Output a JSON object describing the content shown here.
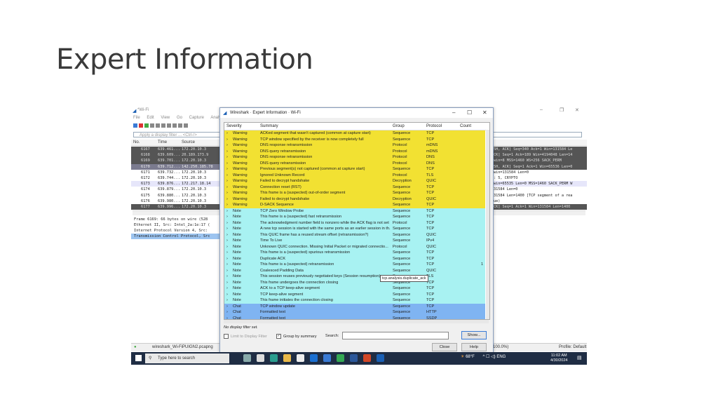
{
  "slide": {
    "title": "Expert Information"
  },
  "main_window": {
    "title": "*Wi-Fi",
    "menu": [
      "File",
      "Edit",
      "View",
      "Go",
      "Capture",
      "Analyze"
    ],
    "filter_placeholder": "Apply a display filter ... <Ctrl-/>",
    "columns": {
      "no": "No.",
      "time": "Time",
      "source": "Source"
    },
    "packets": [
      {
        "no": "6167",
        "time": "639.461...",
        "src": "172.20.10.3",
        "style": "dark"
      },
      {
        "no": "6168",
        "time": "639.609...",
        "src": "20.189.173.9",
        "style": "dark"
      },
      {
        "no": "6169",
        "time": "639.701...",
        "src": "172.20.10.3",
        "style": "dark"
      },
      {
        "no": "6170",
        "time": "639.712...",
        "src": "142.250.185.78",
        "style": "sel"
      },
      {
        "no": "6171",
        "time": "639.732...",
        "src": "172.20.10.3",
        "style": "plain"
      },
      {
        "no": "6172",
        "time": "639.744...",
        "src": "172.20.10.3",
        "style": "plain"
      },
      {
        "no": "6173",
        "time": "639.876...",
        "src": "172.217.18.14",
        "style": "lt"
      },
      {
        "no": "6174",
        "time": "639.879...",
        "src": "172.20.10.3",
        "style": "plain"
      },
      {
        "no": "6175",
        "time": "639.880...",
        "src": "172.20.10.3",
        "style": "plain"
      },
      {
        "no": "6176",
        "time": "639.980...",
        "src": "172.20.10.3",
        "style": "plain"
      },
      {
        "no": "6177",
        "time": "639.996...",
        "src": "172.20.10.3",
        "style": "dark"
      }
    ],
    "info_right": [
      {
        "text": "5H, ACK] Seq=340 Ack=1 Win=131584 Le",
        "style": "dark"
      },
      {
        "text": "CK] Seq=1 Ack=189 Win=4194048 Len=14",
        "style": "dark"
      },
      {
        "text": "win=8 MSS=1460 WS=256 SACK_PERM",
        "style": "dark"
      },
      {
        "text": "5H, ACK] Seq=1 Ack=1 Win=65536 Len=0",
        "style": "sel"
      },
      {
        "text": "win=131584 Len=0",
        "style": "plain"
      },
      {
        "text": ": 5, CRYPTO",
        "style": "plain"
      },
      {
        "text": "win=65535 Len=0 MSS=1460 SACK_PERM W",
        "style": "lt"
      },
      {
        "text": "31584 Len=0",
        "style": "plain"
      },
      {
        "text": "31584 Len=1400 [TCP segment of a rea",
        "style": "plain"
      },
      {
        "text": "ue)",
        "style": "plain"
      },
      {
        "text": "CK] Seq=1 Ack=1 Win=131584 Len=1400",
        "style": "dark"
      }
    ],
    "details": [
      "Frame 6169: 66 bytes on wire (528",
      "Ethernet II, Src: Intel_2a:1e:17 (",
      "Internet Protocol Version 4, Src:",
      "Transmission Control Protocol, Src"
    ],
    "status": {
      "file": "wireshark_Wi-FiPUIGN2.pcapng",
      "pct": "100.0%)",
      "profile": "Profile: Default"
    }
  },
  "dialog": {
    "title": "Wireshark · Expert Information · Wi-Fi",
    "columns": {
      "severity": "Severity",
      "summary": "Summary",
      "group": "Group",
      "protocol": "Protocol",
      "count": "Count"
    },
    "rows": [
      {
        "sev": "Warning",
        "sum": "ACKed segment that wasn't captured (common at capture start)",
        "grp": "Sequence",
        "proto": "TCP",
        "count": "",
        "cls": "warn"
      },
      {
        "sev": "Warning",
        "sum": "TCP window specified by the receiver is now completely full",
        "grp": "Sequence",
        "proto": "TCP",
        "count": "",
        "cls": "warn"
      },
      {
        "sev": "Warning",
        "sum": "DNS response retransmission",
        "grp": "Protocol",
        "proto": "mDNS",
        "count": "",
        "cls": "warn"
      },
      {
        "sev": "Warning",
        "sum": "DNS query retransmission",
        "grp": "Protocol",
        "proto": "mDNS",
        "count": "",
        "cls": "warn"
      },
      {
        "sev": "Warning",
        "sum": "DNS response retransmission",
        "grp": "Protocol",
        "proto": "DNS",
        "count": "",
        "cls": "warn"
      },
      {
        "sev": "Warning",
        "sum": "DNS query retransmission",
        "grp": "Protocol",
        "proto": "DNS",
        "count": "",
        "cls": "warn"
      },
      {
        "sev": "Warning",
        "sum": "Previous segment(s) not captured (common at capture start)",
        "grp": "Sequence",
        "proto": "TCP",
        "count": "",
        "cls": "warn"
      },
      {
        "sev": "Warning",
        "sum": "Ignored Unknown Record",
        "grp": "Protocol",
        "proto": "TLS",
        "count": "",
        "cls": "warn"
      },
      {
        "sev": "Warning",
        "sum": "Failed to decrypt handshake",
        "grp": "Decryption",
        "proto": "QUIC",
        "count": "",
        "cls": "warn"
      },
      {
        "sev": "Warning",
        "sum": "Connection reset (RST)",
        "grp": "Sequence",
        "proto": "TCP",
        "count": "",
        "cls": "warn"
      },
      {
        "sev": "Warning",
        "sum": "This frame is a (suspected) out-of-order segment",
        "grp": "Sequence",
        "proto": "TCP",
        "count": "",
        "cls": "warn"
      },
      {
        "sev": "Warning",
        "sum": "Failed to decrypt handshake",
        "grp": "Decryption",
        "proto": "QUIC",
        "count": "",
        "cls": "warn"
      },
      {
        "sev": "Warning",
        "sum": "D-SACK Sequence",
        "grp": "Sequence",
        "proto": "TCP",
        "count": "",
        "cls": "warn"
      },
      {
        "sev": "Note",
        "sum": "TCP Zero Window Probe",
        "grp": "Sequence",
        "proto": "TCP",
        "count": "",
        "cls": "note"
      },
      {
        "sev": "Note",
        "sum": "This frame is a (suspected) fast retransmission",
        "grp": "Sequence",
        "proto": "TCP",
        "count": "",
        "cls": "note"
      },
      {
        "sev": "Note",
        "sum": "The acknowledgment number field is nonzero while the ACK flag is not set",
        "grp": "Protocol",
        "proto": "TCP",
        "count": "",
        "cls": "note"
      },
      {
        "sev": "Note",
        "sum": "A new tcp session is started with the same ports as an earlier session in th...",
        "grp": "Sequence",
        "proto": "TCP",
        "count": "",
        "cls": "note"
      },
      {
        "sev": "Note",
        "sum": "This QUIC frame has a reused stream offset (retransmission?)",
        "grp": "Sequence",
        "proto": "QUIC",
        "count": "",
        "cls": "note"
      },
      {
        "sev": "Note",
        "sum": "Time To Live",
        "grp": "Sequence",
        "proto": "IPv4",
        "count": "",
        "cls": "note"
      },
      {
        "sev": "Note",
        "sum": "Unknown QUIC connection. Missing Initial Packet or migrated connectio...",
        "grp": "Protocol",
        "proto": "QUIC",
        "count": "",
        "cls": "note"
      },
      {
        "sev": "Note",
        "sum": "This frame is a (suspected) spurious retransmission",
        "grp": "Sequence",
        "proto": "TCP",
        "count": "",
        "cls": "note"
      },
      {
        "sev": "Note",
        "sum": "Duplicate ACK",
        "grp": "Sequence",
        "proto": "TCP",
        "count": "",
        "cls": "note"
      },
      {
        "sev": "Note",
        "sum": "This frame is a (suspected) retransmission",
        "grp": "Sequence",
        "proto": "TCP",
        "count": "1",
        "cls": "note"
      },
      {
        "sev": "Note",
        "sum": "Coalesced Padding Data",
        "grp": "Sequence",
        "proto": "QUIC",
        "count": "",
        "cls": "note"
      },
      {
        "sev": "Note",
        "sum": "This session reuses previously negotiated keys (Session resumption)",
        "grp": "Sequence",
        "proto": "TLS",
        "count": "",
        "cls": "note"
      },
      {
        "sev": "Note",
        "sum": "This frame undergoes the connection closing",
        "grp": "Sequence",
        "proto": "TCP",
        "count": "",
        "cls": "note"
      },
      {
        "sev": "Note",
        "sum": "ACK to a TCP keep-alive segment",
        "grp": "Sequence",
        "proto": "TCP",
        "count": "",
        "cls": "note"
      },
      {
        "sev": "Note",
        "sum": "TCP keep-alive segment",
        "grp": "Sequence",
        "proto": "TCP",
        "count": "",
        "cls": "note"
      },
      {
        "sev": "Note",
        "sum": "This frame initiates the connection closing",
        "grp": "Sequence",
        "proto": "TCP",
        "count": "",
        "cls": "note"
      },
      {
        "sev": "Chat",
        "sum": "TCP window update",
        "grp": "Sequence",
        "proto": "TCP",
        "count": "",
        "cls": "chat"
      },
      {
        "sev": "Chat",
        "sum": "Formatted text",
        "grp": "Sequence",
        "proto": "HTTP",
        "count": "",
        "cls": "chat"
      },
      {
        "sev": "Chat",
        "sum": "Formatted text",
        "grp": "Sequence",
        "proto": "SSDP",
        "count": "",
        "cls": "chat"
      }
    ],
    "tooltip": "tcp.analysis.duplicate_ack",
    "display_filter_status": "No display filter set.",
    "limit_label": "Limit to Display Filter",
    "group_by_summary_label": "Group by summary",
    "group_by_summary_checked": true,
    "search_label": "Search:",
    "search_value": "",
    "show_button": "Show...",
    "close_button": "Close",
    "help_button": "Help"
  },
  "taskbar": {
    "search_placeholder": "Type here to search",
    "temperature": "68°F",
    "language": "ENG",
    "time": "11:02 AM",
    "date": "4/30/2024"
  }
}
